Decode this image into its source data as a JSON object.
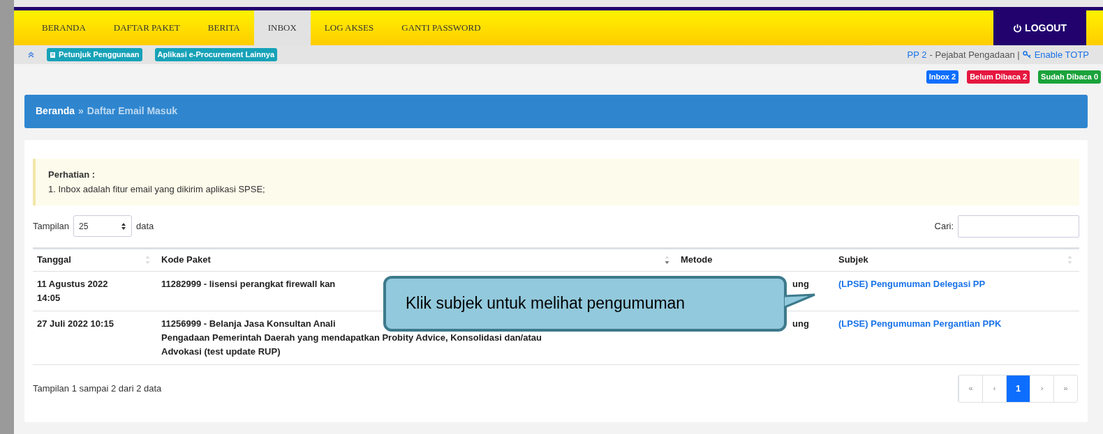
{
  "nav": {
    "tabs": [
      {
        "label": "BERANDA",
        "selected": false
      },
      {
        "label": "DAFTAR PAKET",
        "selected": false
      },
      {
        "label": "BERITA",
        "selected": false
      },
      {
        "label": "INBOX",
        "selected": true
      },
      {
        "label": "LOG AKSES",
        "selected": false
      },
      {
        "label": "GANTI PASSWORD",
        "selected": false
      }
    ],
    "logout": "LOGOUT"
  },
  "subbar": {
    "buttons": [
      "Petunjuk Penggunaan",
      "Aplikasi e-Procurement Lainnya"
    ],
    "user": "PP 2",
    "role": "- Pejabat Pengadaan |",
    "totp": "Enable TOTP"
  },
  "badges": [
    {
      "label": "Inbox 2",
      "color": "#0d6efd"
    },
    {
      "label": "Belum Dibaca 2",
      "color": "#e5173f"
    },
    {
      "label": "Sudah Dibaca 0",
      "color": "#1aa33a"
    }
  ],
  "breadcrumb": {
    "home": "Beranda",
    "sep": "»",
    "current": "Daftar Email Masuk"
  },
  "notice": {
    "title": "Perhatian :",
    "text": "1. Inbox adalah fitur email yang dikirim aplikasi SPSE;"
  },
  "length": {
    "label": "Tampilan",
    "value": "25",
    "suffix": "data"
  },
  "search": {
    "label": "Cari:"
  },
  "table": {
    "columns": [
      "Tanggal",
      "Kode Paket",
      "Metode",
      "Subjek"
    ],
    "rows": [
      {
        "tanggal": "11 Agustus 2022 14:05",
        "kode": [
          "11282999 - lisensi perangkat firewall kan"
        ],
        "metode": "ung",
        "subjek": "(LPSE) Pengumuman Delegasi PP"
      },
      {
        "tanggal": "27 Juli 2022 10:15",
        "kode": [
          "11256999 - Belanja Jasa Konsultan Anali",
          "Pengadaan Pemerintah Daerah yang mendapatkan Probity Advice, Konsolidasi dan/atau",
          "Advokasi (test update RUP)"
        ],
        "metode": "ung",
        "subjek": "(LPSE) Pengumuman Pergantian PPK"
      }
    ]
  },
  "info": "Tampilan 1 sampai 2 dari 2 data",
  "pagination": [
    {
      "label": "«",
      "selected": false
    },
    {
      "label": "‹",
      "selected": false
    },
    {
      "label": "1",
      "selected": true
    },
    {
      "label": "›",
      "selected": false
    },
    {
      "label": "»",
      "selected": false
    }
  ],
  "callout": "Klik subjek untuk melihat pengumuman"
}
